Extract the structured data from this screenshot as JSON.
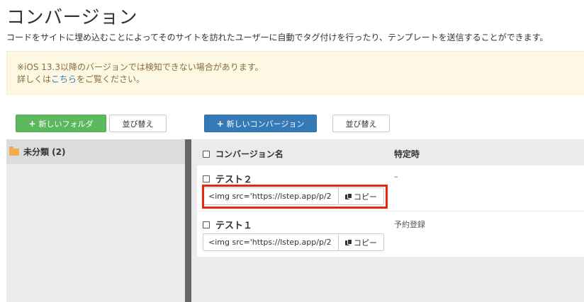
{
  "page": {
    "title": "コンバージョン",
    "description": "コードをサイトに埋め込むことによってそのサイトを訪れたユーザーに自動でタグ付けを行ったり、テンプレートを送信することができます。"
  },
  "notice": {
    "line1": "※iOS 13.3以降のバージョンでは検知できない場合があります。",
    "line2_prefix": "詳しくは",
    "line2_link": "こちら",
    "line2_suffix": "をご覧ください。"
  },
  "toolbar": {
    "new_folder_label": "新しいフォルダ",
    "sort_folders_label": "並び替え",
    "new_conversion_label": "新しいコンバージョン",
    "sort_conversions_label": "並び替え"
  },
  "folders": [
    {
      "label": "未分類 (2)"
    }
  ],
  "table": {
    "col_name": "コンバージョン名",
    "col_time": "特定時",
    "rows": [
      {
        "name": "テスト２",
        "time": "–",
        "code": "<img src='https://lstep.app/p/2",
        "copy_label": "コピー"
      },
      {
        "name": "テスト１",
        "time": "予約登録",
        "code": "<img src='https://lstep.app/p/2",
        "copy_label": "コピー"
      }
    ]
  },
  "colors": {
    "highlight": "#e8260c",
    "green": "#5cb85c",
    "blue": "#337ab7",
    "notice_bg": "#fcf8e3"
  },
  "icons": {
    "folder": "folder-open-icon",
    "copy": "clipboard-icon",
    "plus": "plus-icon"
  }
}
